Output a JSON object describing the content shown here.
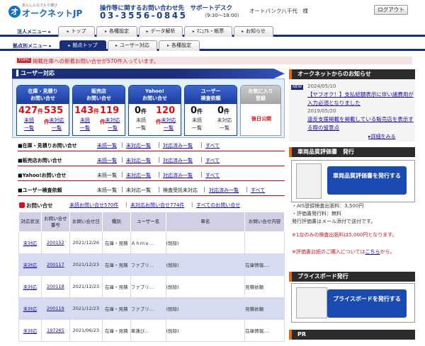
{
  "header": {
    "logo_tagline": "あんしんなクルマ選び",
    "logo_name": "オークネットJP",
    "logo_mark": "オ",
    "support_label": "操作等に関するお問い合わせ先　サポートデスク",
    "support_tel": "03-3556-0845",
    "support_hours": "（9:30～18:00）",
    "user_name": "オートバンク八千代　様",
    "logout_label": "ログアウト"
  },
  "corp_menu": {
    "label": "法人メニュー ▸",
    "tabs": [
      "トップ",
      "各種設定",
      "データ解析",
      "ﾏﾆｭｱﾙ・帳票",
      "お知らせ"
    ]
  },
  "store_menu": {
    "label": "拠点別メニュー ▸",
    "tabs": [
      "拠点トップ",
      "ユーザー対応",
      "各種設定"
    ]
  },
  "topic": {
    "badge": "TOPIC",
    "text": "掲載在庫への新着お問い合せが570件入っています。"
  },
  "section_title": "ユーザー対応",
  "cards": [
    {
      "title1": "在庫・見積り",
      "title2": "お問い合せ",
      "n1": "427",
      "n2": "535",
      "unit": "件",
      "red": true,
      "l1a": "未読",
      "l1b": "一覧",
      "l2a": "未対応",
      "l2b": "一覧"
    },
    {
      "title1": "販売店",
      "title2": "お問い合せ",
      "n1": "143",
      "n2": "119",
      "unit": "件",
      "red": true,
      "l1a": "未読",
      "l1b": "一覧",
      "l2a": "未対応",
      "l2b": "一覧"
    },
    {
      "title1": "Yahoo!",
      "title2": "お問い合せ",
      "n1": "0",
      "n2": "120",
      "unit": "件",
      "red": "mixed",
      "l1a": "未読",
      "l1b": "一覧",
      "l2a": "未対応",
      "l2b": "一覧"
    },
    {
      "title1": "ユーザー",
      "title2": "検査依頼",
      "n1": "0",
      "n2": "0",
      "unit": "件",
      "red": false,
      "l1a": "未読",
      "l1b": "一覧",
      "l2a": "未対応",
      "l2b": "一覧"
    }
  ],
  "fav_card": {
    "title1": "お気に入り",
    "title2": "登録",
    "pub": "後日公開"
  },
  "inquiry_rows": [
    {
      "name": "■在庫・見積りお問い合せ",
      "links": [
        "未読一覧",
        "未対応一覧",
        "対応済み一覧",
        "すべて"
      ]
    },
    {
      "name": "■販売店お問い合せ",
      "links": [
        "未読一覧",
        "未対応一覧",
        "対応済み一覧",
        "すべて"
      ]
    },
    {
      "name": "■Yahoo!お問い合せ",
      "links": [
        "未読一覧",
        "未対応一覧",
        "対応済み一覧",
        "すべて"
      ]
    },
    {
      "name": "■ユーザー検査依頼",
      "plain": [
        "未読一覧",
        "未対応一覧",
        "検査受託未対応"
      ],
      "links": [
        "対応済み一覧",
        "すべて"
      ]
    }
  ],
  "list": {
    "title": "お問い合せ",
    "links": [
      "未読お問い合せ570件",
      "未対応お問い合せ774件",
      "すべてのお問い合せ"
    ]
  },
  "table": {
    "headers": [
      "対応状況",
      "お問い合せ番号",
      "お問い合せ日",
      "種別",
      "ユーザー名",
      "車名",
      "お問い合せ内容"
    ],
    "rows": [
      [
        "未対応",
        "200152",
        "2021/12/26",
        "在庫・見積",
        "Ａｈｍｅ…",
        "(削除)",
        ""
      ],
      [
        "未対応",
        "200117",
        "2021/12/23",
        "在庫・見積",
        "ファブリ…",
        "(削除)",
        "在庫情報,…"
      ],
      [
        "未対応",
        "200118",
        "2021/12/23",
        "在庫・見積",
        "ファブリ…",
        "(削除)",
        "見積依頼"
      ],
      [
        "未対応",
        "200119",
        "2021/12/23",
        "在庫・見積",
        "ファブリ…",
        "(削除)",
        "見積依頼"
      ],
      [
        "未対応",
        "197265",
        "2021/06/23",
        "在庫・見積",
        "車蓮び…",
        "(削除)",
        "在庫情報,…"
      ]
    ]
  },
  "right": {
    "news_title": "オークネットからのお知らせ",
    "new_badge": "NEW",
    "news": [
      {
        "date": "2024/05/10",
        "text": "【ヤフオク！】支払総額表示に伴い諸費用が入力必須となりました"
      },
      {
        "date": "2019/05/20",
        "text": "違反支援掲載を掲載している販売店を表示する際の留意点"
      }
    ],
    "more": "▸詳細をみる",
    "cert_title": "車両品質評価書　発行",
    "cert_button": "車両品質評価書を発行する",
    "cert_lines": [
      "・AIS登録検査出張料：3,500円",
      "・評価書発行料：無料",
      "発行評価書はメール添付で送付です。"
    ],
    "cert_red1": "※1台のみの検査出張料は5,000円となります。",
    "cert_red2": "※評価書台紙のご購入については",
    "cert_red2_link": "こちら",
    "cert_red2_tail": "から。",
    "pp_title": "プライスボード発行",
    "pp_button": "プライスボードを発行する",
    "pr_title": "PR"
  }
}
